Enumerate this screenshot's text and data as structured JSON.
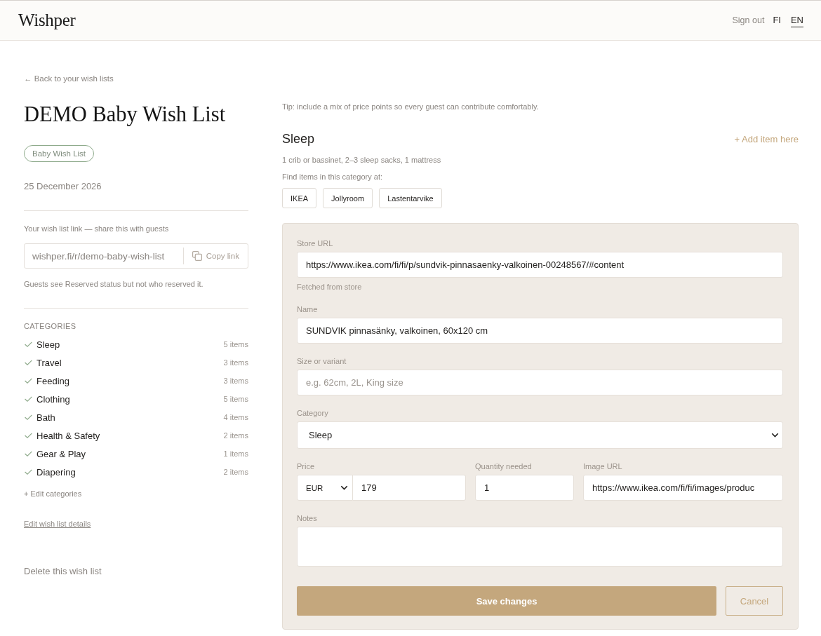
{
  "header": {
    "logo": "Wishper",
    "sign_out": "Sign out",
    "languages": [
      {
        "label": "FI",
        "selected": false
      },
      {
        "label": "EN",
        "selected": true
      }
    ]
  },
  "sidebar": {
    "back_link": "← Back to your wish lists",
    "title": "DEMO Baby Wish List",
    "tag": "Baby Wish List",
    "date": "25 December 2026",
    "share": {
      "label": "Your wish list link — share this with guests",
      "url": "wishper.fi/r/demo-baby-wish-list",
      "copy_button": "Copy link",
      "note": "Guests see Reserved status but not who reserved it."
    },
    "categories": {
      "heading": "CATEGORIES",
      "items": [
        {
          "name": "Sleep",
          "count": "5 items",
          "checked": true
        },
        {
          "name": "Travel",
          "count": "3 items",
          "checked": true
        },
        {
          "name": "Feeding",
          "count": "3 items",
          "checked": true
        },
        {
          "name": "Clothing",
          "count": "5 items",
          "checked": true
        },
        {
          "name": "Bath",
          "count": "4 items",
          "checked": true
        },
        {
          "name": "Health & Safety",
          "count": "2 items",
          "checked": true
        },
        {
          "name": "Gear & Play",
          "count": "1 items",
          "checked": true
        },
        {
          "name": "Diapering",
          "count": "2 items",
          "checked": true
        }
      ],
      "edit_link": "+ Edit categories"
    },
    "edit_details_link": "Edit wish list details",
    "delete_link": "Delete this wish list"
  },
  "main": {
    "tip": "Tip: include a mix of price points so every guest can contribute comfortably.",
    "section": {
      "title": "Sleep",
      "add_link": "+ Add item here",
      "hint": "1 crib or bassinet, 2–3 sleep sacks, 1 mattress",
      "stores_label": "Find items in this category at:",
      "stores": [
        "IKEA",
        "Jollyroom",
        "Lastentarvike"
      ]
    },
    "form": {
      "store_url": {
        "label": "Store URL",
        "value": "https://www.ikea.com/fi/fi/p/sundvik-pinnasaenky-valkoinen-00248567/#content",
        "note": "Fetched from store"
      },
      "name": {
        "label": "Name",
        "value": "SUNDVIK pinnasänky, valkoinen, 60x120 cm"
      },
      "size": {
        "label": "Size or variant",
        "placeholder": "e.g. 62cm, 2L, King size"
      },
      "category": {
        "label": "Category",
        "value": "Sleep"
      },
      "price": {
        "label": "Price",
        "currency": "EUR",
        "value": "179"
      },
      "quantity": {
        "label": "Quantity needed",
        "value": "1"
      },
      "image_url": {
        "label": "Image URL",
        "value": "https://www.ikea.com/fi/fi/images/produc"
      },
      "notes": {
        "label": "Notes"
      },
      "save_button": "Save changes",
      "cancel_button": "Cancel"
    }
  }
}
